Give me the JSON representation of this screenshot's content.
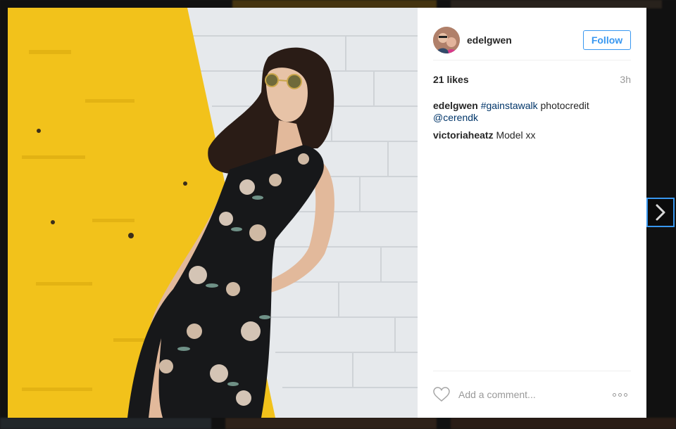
{
  "post": {
    "username": "edelgwen",
    "follow_label": "Follow",
    "likes": "21 likes",
    "time": "3h"
  },
  "comments": [
    {
      "user": "edelgwen",
      "hashtag": "#gainstawalk",
      "text": " photocredit ",
      "mention": "@cerendk"
    },
    {
      "user": "victoriaheatz",
      "text": " Model xx"
    }
  ],
  "comment_input": {
    "placeholder": "Add a comment..."
  },
  "icons": {
    "heart": "heart-icon",
    "more": "more-options-icon",
    "next": "chevron-right-icon"
  },
  "colors": {
    "accent": "#3897f0",
    "link": "#003569",
    "muted": "#999999",
    "text": "#262626",
    "wall_yellow": "#f2c21b"
  }
}
